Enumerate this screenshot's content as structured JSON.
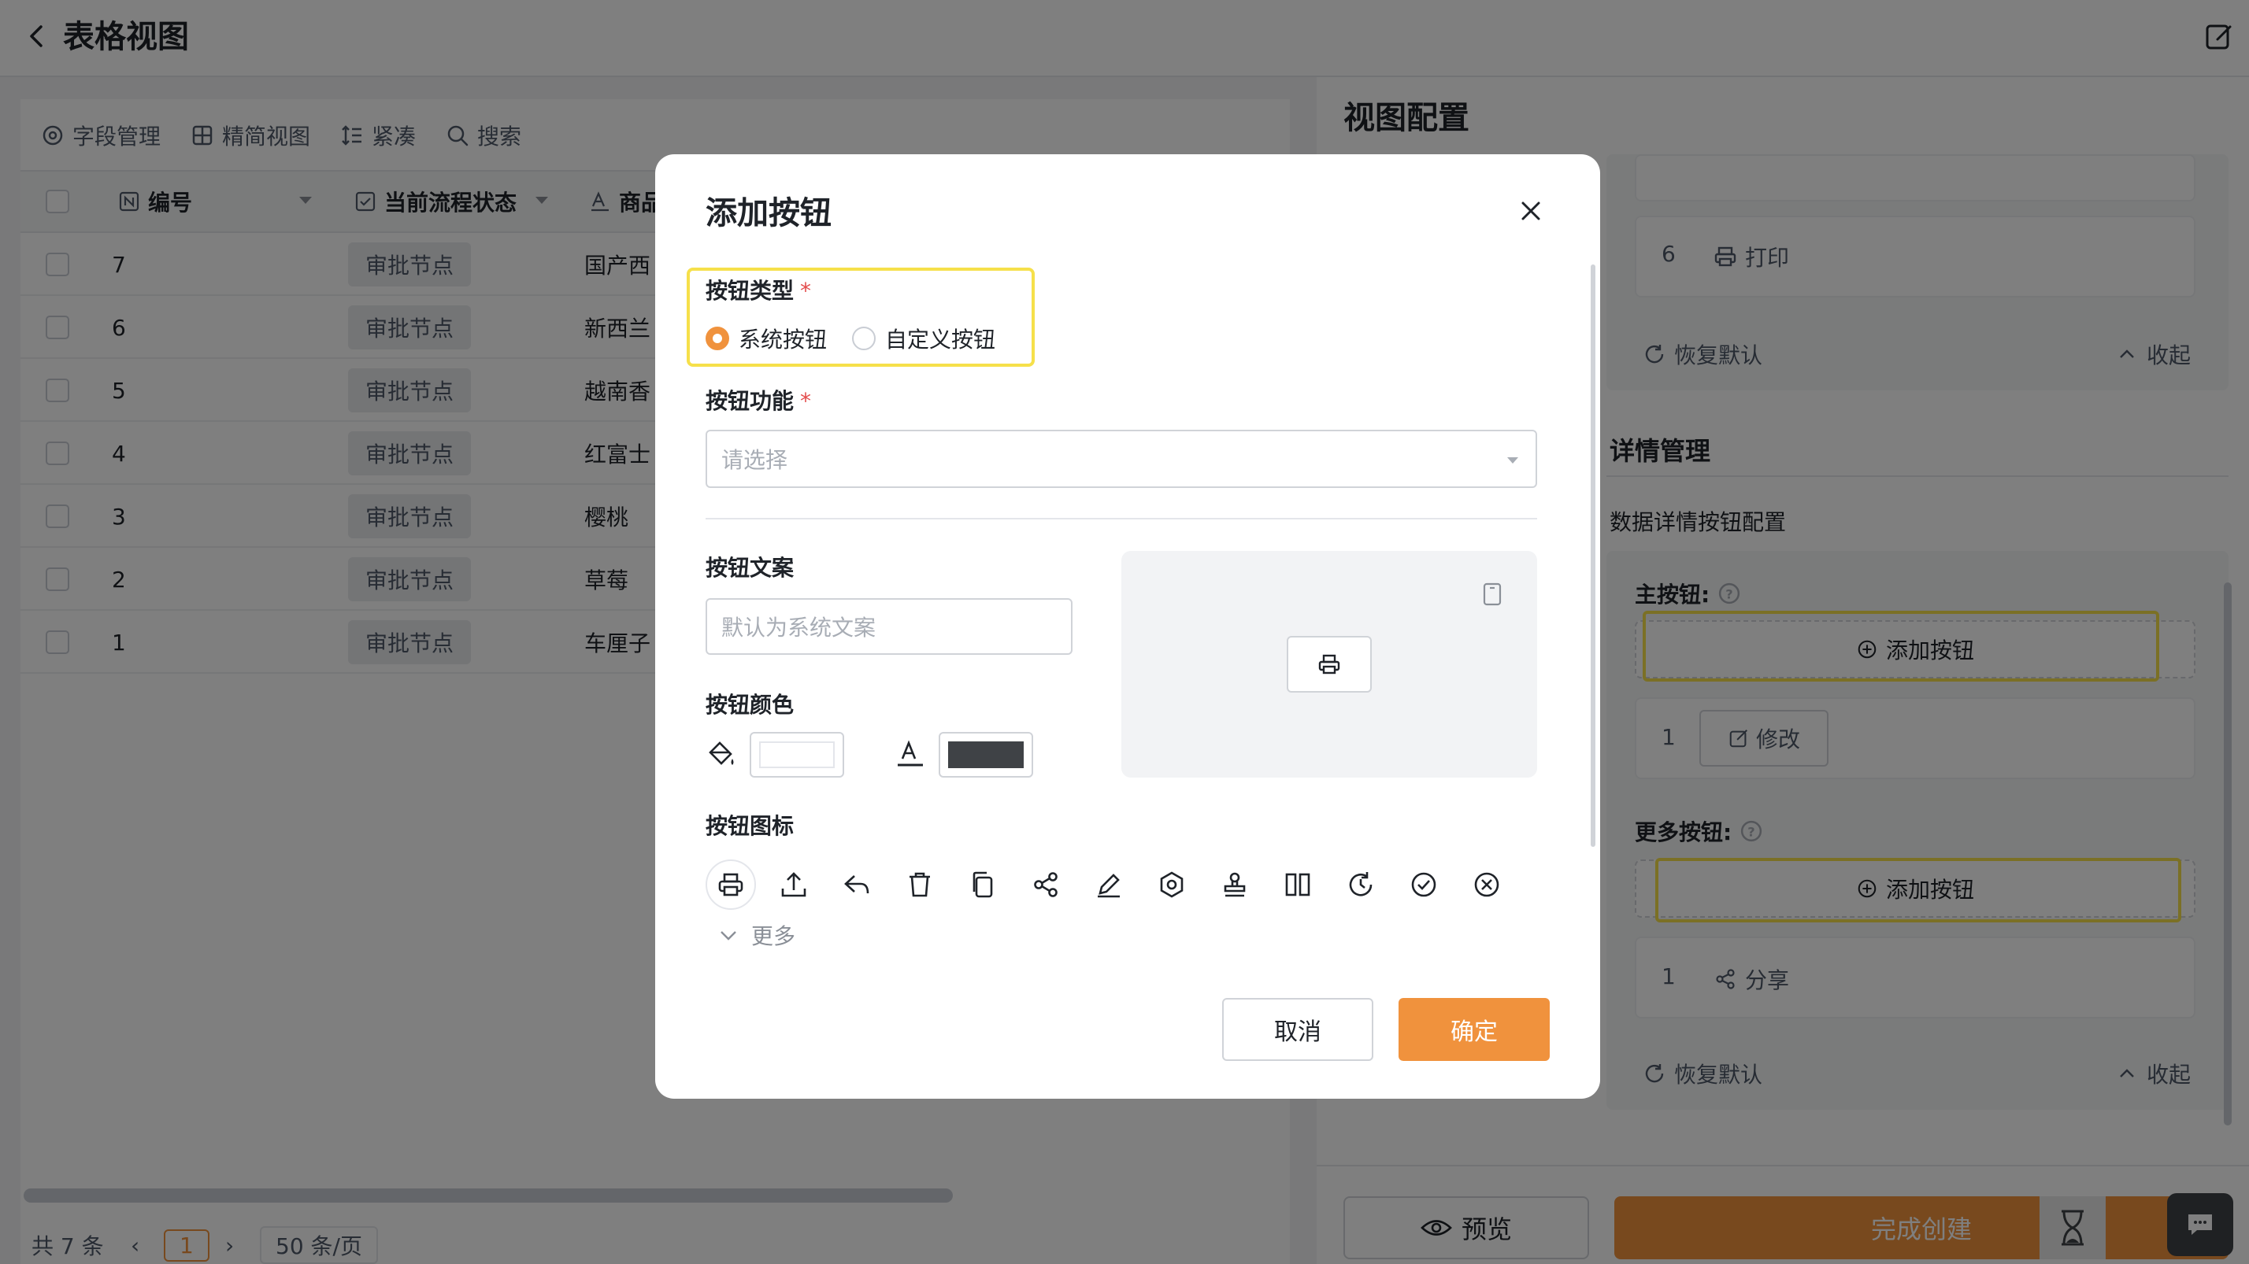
{
  "header": {
    "title": "表格视图"
  },
  "toolbar": [
    {
      "label": "字段管理",
      "icon": "settings-icon"
    },
    {
      "label": "精简视图",
      "icon": "grid-icon"
    },
    {
      "label": "紧凑",
      "icon": "row-height-icon"
    },
    {
      "label": "搜索",
      "icon": "search-icon"
    }
  ],
  "table": {
    "columns": [
      "编号",
      "当前流程状态",
      "商品"
    ],
    "rows": [
      {
        "id": "7",
        "status": "审批节点",
        "product": "国产西"
      },
      {
        "id": "6",
        "status": "审批节点",
        "product": "新西兰"
      },
      {
        "id": "5",
        "status": "审批节点",
        "product": "越南香"
      },
      {
        "id": "4",
        "status": "审批节点",
        "product": "红富士"
      },
      {
        "id": "3",
        "status": "审批节点",
        "product": "樱桃"
      },
      {
        "id": "2",
        "status": "审批节点",
        "product": "草莓"
      },
      {
        "id": "1",
        "status": "审批节点",
        "product": "车厘子"
      }
    ]
  },
  "pagination": {
    "total": "共 7 条",
    "current_page": "1",
    "page_size": "50 条/页"
  },
  "view_config": {
    "title": "视图配置",
    "list_items": [
      {
        "index": "6",
        "label": "打印"
      }
    ],
    "restore_label": "恢复默认",
    "collapse_label": "收起",
    "detail_section_title": "详情管理",
    "detail_subtitle": "数据详情按钮配置",
    "primary_label": "主按钮:",
    "add_button_label": "添加按钮",
    "primary_items": [
      {
        "index": "1",
        "label": "修改"
      }
    ],
    "more_label": "更多按钮:",
    "more_items": [
      {
        "index": "1",
        "label": "分享"
      }
    ],
    "preview_label": "预览",
    "finish_label": "完成创建"
  },
  "modal": {
    "title": "添加按钮",
    "type_label": "按钮类型",
    "type_options": [
      "系统按钮",
      "自定义按钮"
    ],
    "selected_type": "系统按钮",
    "function_label": "按钮功能",
    "function_placeholder": "请选择",
    "text_label": "按钮文案",
    "text_placeholder": "默认为系统文案",
    "color_label": "按钮颜色",
    "bg_color": "#ffffff",
    "text_color": "#3f4246",
    "icon_label": "按钮图标",
    "icons": [
      "printer-icon",
      "upload-icon",
      "reply-icon",
      "trash-icon",
      "copy-icon",
      "share-icon",
      "pencil-icon",
      "settings-icon",
      "stamp-icon",
      "columns-icon",
      "refresh-icon",
      "check-circle-icon",
      "close-circle-icon"
    ],
    "selected_icon": "printer-icon",
    "more_label": "更多",
    "cancel_label": "取消",
    "confirm_label": "确定"
  },
  "colors": {
    "accent": "#f0923d",
    "highlight": "#f6e04a"
  }
}
